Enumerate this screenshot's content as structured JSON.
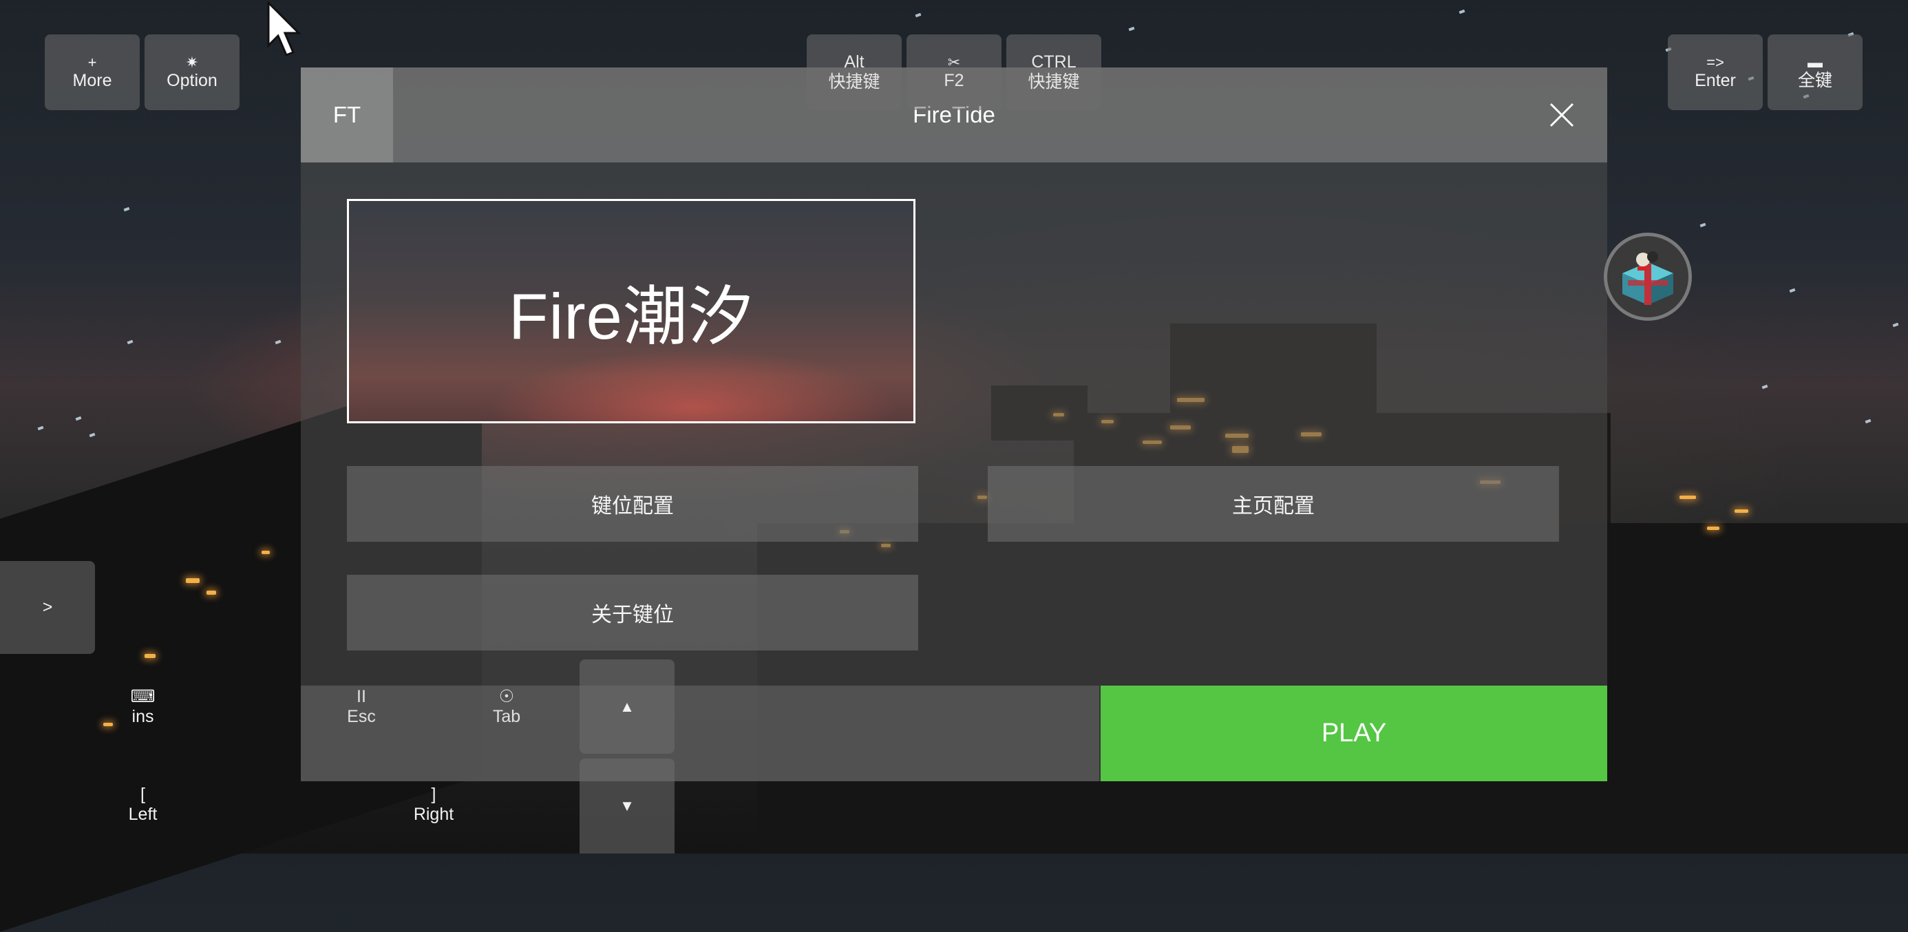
{
  "hud": {
    "more": {
      "icon": "+",
      "label": "More"
    },
    "option": {
      "icon": "✷",
      "label": "Option"
    },
    "alt": {
      "top": "Alt",
      "label": "快捷键"
    },
    "f2": {
      "icon": "✂",
      "label": "F2"
    },
    "ctrl": {
      "top": "CTRL",
      "label": "快捷键"
    },
    "enter": {
      "icon": "=>",
      "label": "Enter"
    },
    "fullkey": {
      "icon": "▬",
      "label": "全键"
    },
    "expand": {
      "label": ">"
    },
    "ins": {
      "icon": "⌨",
      "label": "ins"
    },
    "esc": {
      "icon": "II",
      "label": "Esc"
    },
    "tab": {
      "icon": "☉",
      "label": "Tab"
    },
    "left": {
      "icon": "[",
      "label": "Left"
    },
    "right": {
      "icon": "]",
      "label": "Right"
    },
    "up": {
      "icon": "▲"
    },
    "down": {
      "icon": "▼"
    }
  },
  "dialog": {
    "tab_label": "FT",
    "title": "FireTide",
    "banner_text": "Fire潮汐",
    "buttons": {
      "key_config": "键位配置",
      "home_config": "主页配置",
      "about_keys": "关于键位"
    },
    "play_label": "PLAY"
  },
  "colors": {
    "play_green": "#54c644",
    "overlay_gray": "#4e4e4e"
  }
}
